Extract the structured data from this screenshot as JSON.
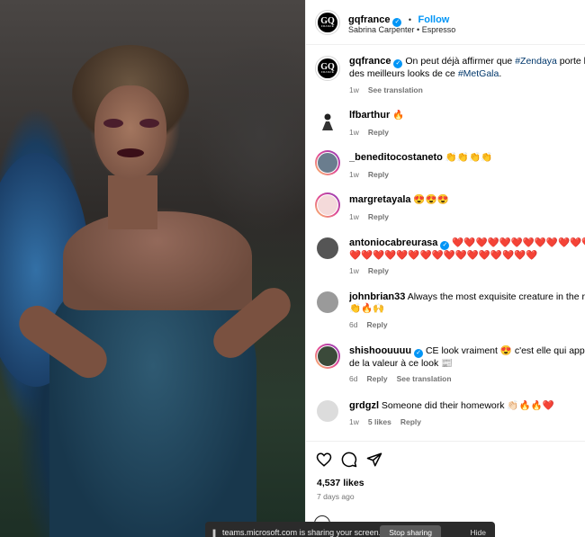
{
  "post": {
    "author": "gqfrance",
    "follow_label": "Follow",
    "separator": "•",
    "audio": "Sabrina Carpenter • Espresso",
    "caption_pre": "On peut déjà affirmer que ",
    "caption_tag1": "#Zendaya",
    "caption_mid": " porte l'un",
    "caption_line2_pre": "des meilleurs looks de ce ",
    "caption_tag2": "#MetGala",
    "caption_end": ".",
    "caption_time": "1w",
    "see_translation": "See translation"
  },
  "comments": [
    {
      "user": "lfbarthur",
      "text": "🔥",
      "time": "1w",
      "reply": "Reply"
    },
    {
      "user": "_beneditocostaneto",
      "text": "👏👏👏👏",
      "time": "1w",
      "reply": "Reply"
    },
    {
      "user": "margretayala",
      "text": "😍😍😍",
      "time": "1w",
      "reply": "Reply"
    },
    {
      "user": "antoniocabreurasa",
      "text": "❤️❤️❤️❤️❤️❤️❤️❤️❤️❤️❤️❤️",
      "text2": "❤️❤️❤️❤️❤️❤️❤️❤️❤️❤️❤️❤️❤️❤️❤️❤️",
      "time": "1w",
      "reply": "Reply"
    },
    {
      "user": "johnbrian33",
      "text": "Always the most exquisite creature in the room",
      "text2": "👏🔥🙌",
      "time": "6d",
      "reply": "Reply"
    },
    {
      "user": "shishoouuuu",
      "text": "CE look vraiment 😍 c'est elle qui apporte",
      "text2": "de la valeur à ce look 📰",
      "time": "6d",
      "reply": "Reply",
      "see_translation": "See translation"
    },
    {
      "user": "grdgzl",
      "text": "Someone did their homework 👏🏻🔥🔥❤️",
      "time": "1w",
      "likes": "5 likes",
      "reply": "Reply"
    }
  ],
  "footer": {
    "likes": "4,537 likes",
    "ago": "7 days ago"
  },
  "toast": {
    "pause": "||",
    "text": "teams.microsoft.com is sharing your screen.",
    "stop_label": "Stop sharing",
    "hide_label": "Hide"
  },
  "colors": {
    "accent": "#0095f6",
    "hashtag": "#00376b",
    "muted": "#737373"
  }
}
